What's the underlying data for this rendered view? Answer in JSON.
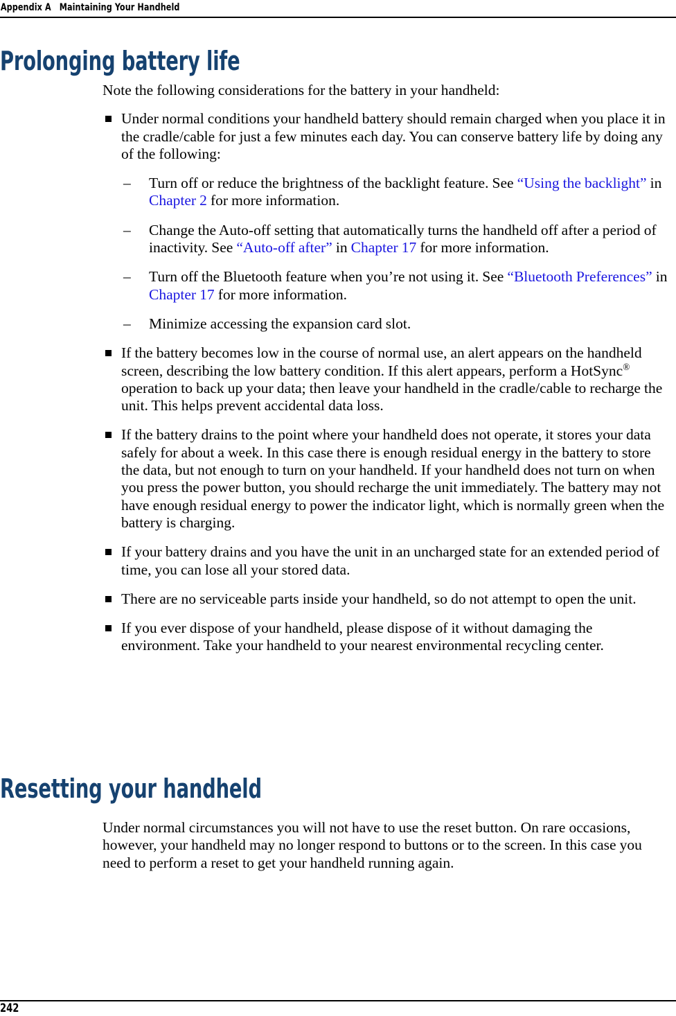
{
  "page": {
    "running_header": "Appendix A   Maintaining Your Handheld",
    "page_number": "242",
    "heading_color": "#164270",
    "link_color": "#1a16e0",
    "text_color": "#000000",
    "background_color": "#ffffff"
  },
  "sections": [
    {
      "heading": "Prolonging battery life",
      "intro": "Note the following considerations for the battery in your handheld:",
      "bullets": [
        {
          "text": "Under normal conditions your handheld battery should remain charged when you place it in the cradle/cable for just a few minutes each day. You can conserve battery life by doing any of the following:",
          "subbullets": [
            {
              "marker": "–",
              "parts": [
                {
                  "t": "Turn off or reduce the brightness of the backlight feature. See ",
                  "link": false
                },
                {
                  "t": "“Using the backlight”",
                  "link": true
                },
                {
                  "t": " in ",
                  "link": false
                },
                {
                  "t": "Chapter 2",
                  "link": true
                },
                {
                  "t": " for more information.",
                  "link": false
                }
              ]
            },
            {
              "marker": "–",
              "parts": [
                {
                  "t": "Change the Auto-off setting that automatically turns the handheld off after a period of inactivity. See ",
                  "link": false
                },
                {
                  "t": "“Auto-off after”",
                  "link": true
                },
                {
                  "t": " in ",
                  "link": false
                },
                {
                  "t": "Chapter 17",
                  "link": true
                },
                {
                  "t": " for more information.",
                  "link": false
                }
              ]
            },
            {
              "marker": "–",
              "parts": [
                {
                  "t": "Turn off the Bluetooth feature when you’re not using it. See ",
                  "link": false
                },
                {
                  "t": "“Bluetooth Preferences”",
                  "link": true
                },
                {
                  "t": " in ",
                  "link": false
                },
                {
                  "t": "Chapter 17",
                  "link": true
                },
                {
                  "t": " for more information.",
                  "link": false
                }
              ]
            },
            {
              "marker": "–",
              "parts": [
                {
                  "t": "Minimize accessing the expansion card slot.",
                  "link": false
                }
              ]
            }
          ]
        },
        {
          "text_before_reg": "If the battery becomes low in the course of normal use, an alert appears on the handheld screen, describing the low battery condition. If this alert appears, perform a HotSync",
          "registered": "®",
          "text_after_reg": " operation to back up your data; then leave your handheld in the cradle/cable to recharge the unit. This helps prevent accidental data loss.",
          "subbullets": []
        },
        {
          "text": "If the battery drains to the point where your handheld does not operate, it stores your data safely for about a week. In this case there is enough residual energy in the battery to store the data, but not enough to turn on your handheld. If your handheld does not turn on when you press the power button, you should recharge the unit immediately. The battery may not have enough residual energy to power the indicator light, which is normally green when the battery is charging.",
          "subbullets": []
        },
        {
          "text": "If your battery drains and you have the unit in an uncharged state for an extended period of time, you can lose all your stored data.",
          "subbullets": []
        },
        {
          "text": "There are no serviceable parts inside your handheld, so do not attempt to open the unit.",
          "subbullets": []
        },
        {
          "text": "If you ever dispose of your handheld, please dispose of it without damaging the environment. Take your handheld to your nearest environmental recycling center.",
          "subbullets": []
        }
      ]
    },
    {
      "heading": "Resetting your handheld",
      "intro": "Under normal circumstances you will not have to use the reset button. On rare occasions, however, your handheld may no longer respond to buttons or to the screen. In this case you need to perform a reset to get your handheld running again.",
      "bullets": []
    }
  ]
}
